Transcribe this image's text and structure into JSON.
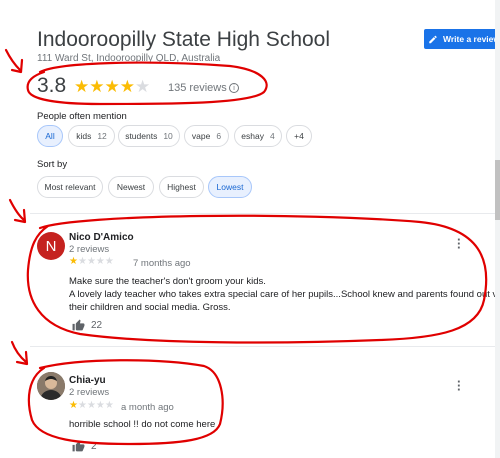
{
  "place": {
    "name": "Indooroopilly State High School",
    "address": "111 Ward St, Indooroopilly QLD, Australia",
    "rating": "3.8",
    "rating_value": 3.8,
    "review_count_label": "135 reviews"
  },
  "write_review_label": "Write a review",
  "mentions": {
    "label": "People often mention",
    "chips": [
      {
        "label": "All",
        "count": ""
      },
      {
        "label": "kids",
        "count": "12"
      },
      {
        "label": "students",
        "count": "10"
      },
      {
        "label": "vape",
        "count": "6"
      },
      {
        "label": "eshay",
        "count": "4"
      },
      {
        "label": "+4",
        "count": ""
      }
    ]
  },
  "sort": {
    "label": "Sort by",
    "options": [
      "Most relevant",
      "Newest",
      "Highest",
      "Lowest"
    ],
    "selected": "Lowest"
  },
  "reviews": [
    {
      "initial": "N",
      "avatar_color": "#c5221f",
      "name": "Nico D'Amico",
      "sub": "2 reviews",
      "stars": 1,
      "time": "7 months ago",
      "text_lines": [
        "Make sure the teacher's don't groom your kids.",
        "A lovely lady teacher who takes extra special care of her pupils...School knew and parents found out via",
        "their children and social media. Gross."
      ],
      "likes": "22"
    },
    {
      "initial": "",
      "avatar_color": "#5f6368",
      "name": "Chia-yu",
      "sub": "2 reviews",
      "stars": 1,
      "time": "a month ago",
      "text_lines": [
        "horrible school !! do not come here"
      ],
      "likes": "2"
    }
  ],
  "colors": {
    "accent": "#1a73e8",
    "star": "#fbbc04",
    "annotation": "#e00000"
  }
}
